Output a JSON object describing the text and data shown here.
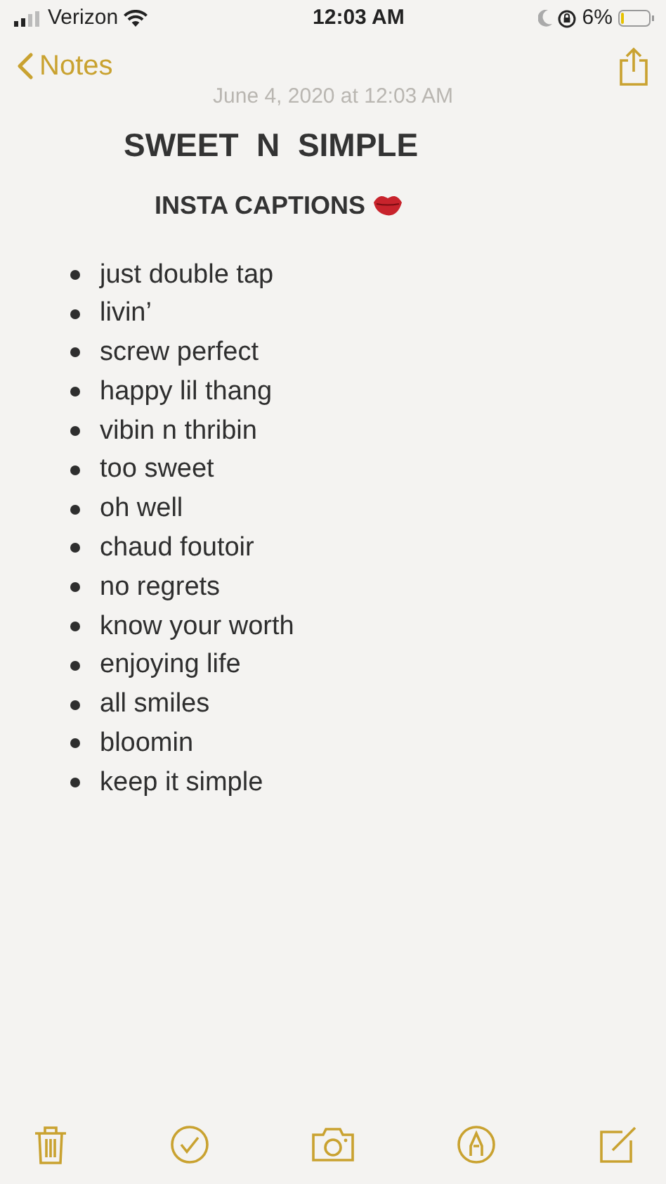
{
  "status_bar": {
    "carrier": "Verizon",
    "time": "12:03 AM",
    "battery": "6%"
  },
  "nav": {
    "back": "Notes"
  },
  "note": {
    "date": "June 4, 2020 at 12:03 AM",
    "title": "SWEET  N  SIMPLE",
    "subtitle": "INSTA CAPTIONS",
    "items": [
      "just double tap",
      "livin’",
      "screw perfect",
      "happy lil thang",
      "vibin n thribin",
      "too sweet",
      "oh well",
      "chaud foutoir",
      "no regrets",
      "know your worth",
      "enjoying life",
      "all smiles",
      "bloomin",
      "keep it simple"
    ]
  }
}
